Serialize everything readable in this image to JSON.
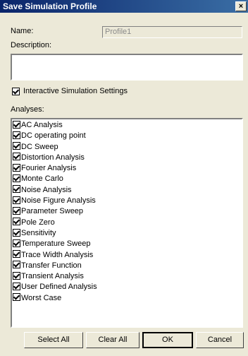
{
  "window": {
    "title": "Save Simulation Profile",
    "close_glyph": "×"
  },
  "form": {
    "name_label": "Name:",
    "name_value": "Profile1",
    "description_label": "Description:",
    "description_value": "",
    "interactive_label": "Interactive Simulation Settings",
    "interactive_checked": true,
    "analyses_label": "Analyses:"
  },
  "analyses": [
    {
      "label": "AC Analysis",
      "checked": true
    },
    {
      "label": "DC operating point",
      "checked": true
    },
    {
      "label": "DC Sweep",
      "checked": true
    },
    {
      "label": "Distortion Analysis",
      "checked": true
    },
    {
      "label": "Fourier Analysis",
      "checked": true
    },
    {
      "label": "Monte Carlo",
      "checked": true
    },
    {
      "label": "Noise Analysis",
      "checked": true
    },
    {
      "label": "Noise Figure Analysis",
      "checked": true
    },
    {
      "label": "Parameter Sweep",
      "checked": true
    },
    {
      "label": "Pole Zero",
      "checked": true
    },
    {
      "label": "Sensitivity",
      "checked": true
    },
    {
      "label": "Temperature Sweep",
      "checked": true
    },
    {
      "label": "Trace Width Analysis",
      "checked": true
    },
    {
      "label": "Transfer Function",
      "checked": true
    },
    {
      "label": "Transient Analysis",
      "checked": true
    },
    {
      "label": "User Defined Analysis",
      "checked": true
    },
    {
      "label": "Worst Case",
      "checked": true
    }
  ],
  "buttons": {
    "select_all": "Select All",
    "clear_all": "Clear All",
    "ok": "OK",
    "cancel": "Cancel"
  }
}
